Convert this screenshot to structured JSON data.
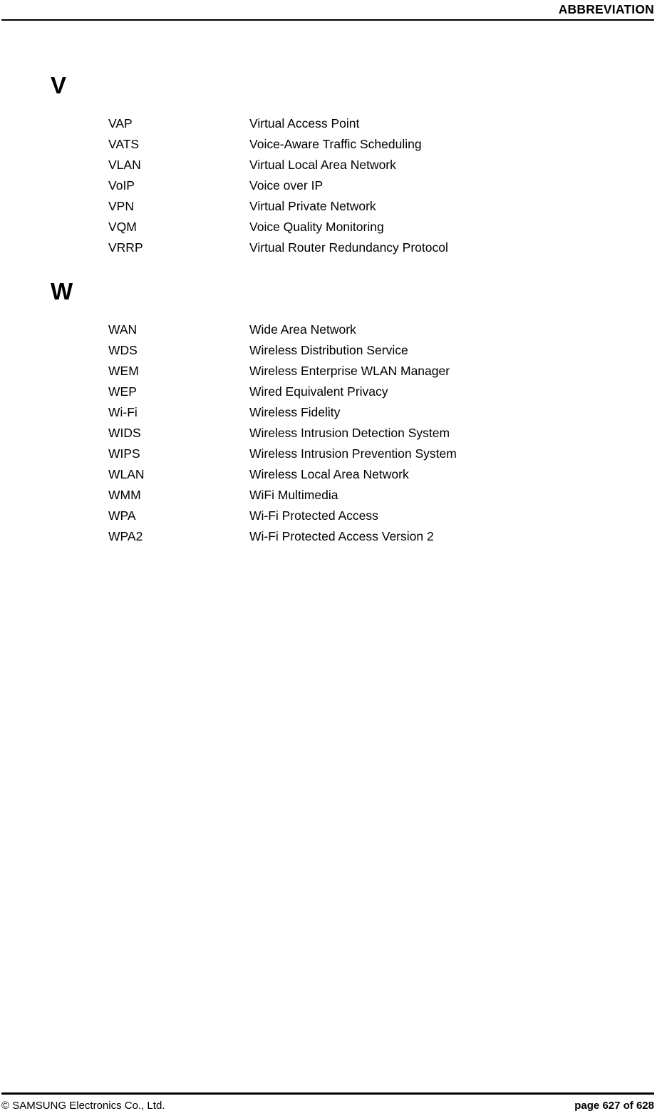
{
  "header": {
    "title": "ABBREVIATION"
  },
  "sections": [
    {
      "letter": "V",
      "entries": [
        {
          "term": "VAP",
          "definition": "Virtual Access Point"
        },
        {
          "term": "VATS",
          "definition": "Voice-Aware Traffic Scheduling"
        },
        {
          "term": "VLAN",
          "definition": "Virtual Local Area Network"
        },
        {
          "term": "VoIP",
          "definition": "Voice over IP"
        },
        {
          "term": "VPN",
          "definition": "Virtual Private Network"
        },
        {
          "term": "VQM",
          "definition": "Voice Quality Monitoring"
        },
        {
          "term": "VRRP",
          "definition": "Virtual Router Redundancy Protocol"
        }
      ]
    },
    {
      "letter": "W",
      "entries": [
        {
          "term": "WAN",
          "definition": "Wide Area Network"
        },
        {
          "term": "WDS",
          "definition": "Wireless Distribution Service"
        },
        {
          "term": "WEM",
          "definition": "Wireless Enterprise WLAN Manager"
        },
        {
          "term": "WEP",
          "definition": "Wired Equivalent Privacy"
        },
        {
          "term": "Wi-Fi",
          "definition": "Wireless Fidelity"
        },
        {
          "term": "WIDS",
          "definition": "Wireless Intrusion Detection System"
        },
        {
          "term": "WIPS",
          "definition": "Wireless Intrusion Prevention System"
        },
        {
          "term": "WLAN",
          "definition": "Wireless Local Area Network"
        },
        {
          "term": "WMM",
          "definition": "WiFi Multimedia"
        },
        {
          "term": "WPA",
          "definition": "Wi-Fi Protected Access"
        },
        {
          "term": "WPA2",
          "definition": "Wi-Fi Protected Access Version 2"
        }
      ]
    }
  ],
  "footer": {
    "copyright": "© SAMSUNG Electronics Co., Ltd.",
    "page_label": "page 627 of 628"
  }
}
